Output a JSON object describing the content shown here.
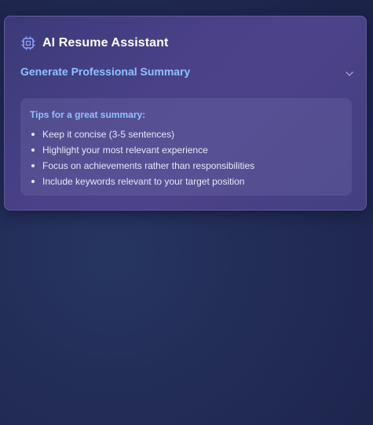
{
  "header": {
    "icon": "chip-icon",
    "title": "AI Resume Assistant"
  },
  "section": {
    "title": "Generate Professional Summary",
    "toggle_icon": "chevron-down-icon",
    "expanded": true
  },
  "tips": {
    "title": "Tips for a great summary:",
    "items": [
      "Keep it concise (3-5 sentences)",
      "Highlight your most relevant experience",
      "Focus on achievements rather than responsibilities",
      "Include keywords relevant to your target position"
    ]
  },
  "colors": {
    "accent": "#8ec2ff",
    "background": "#222c55",
    "card": "#4a4188",
    "icon": "#8ea6ff"
  }
}
